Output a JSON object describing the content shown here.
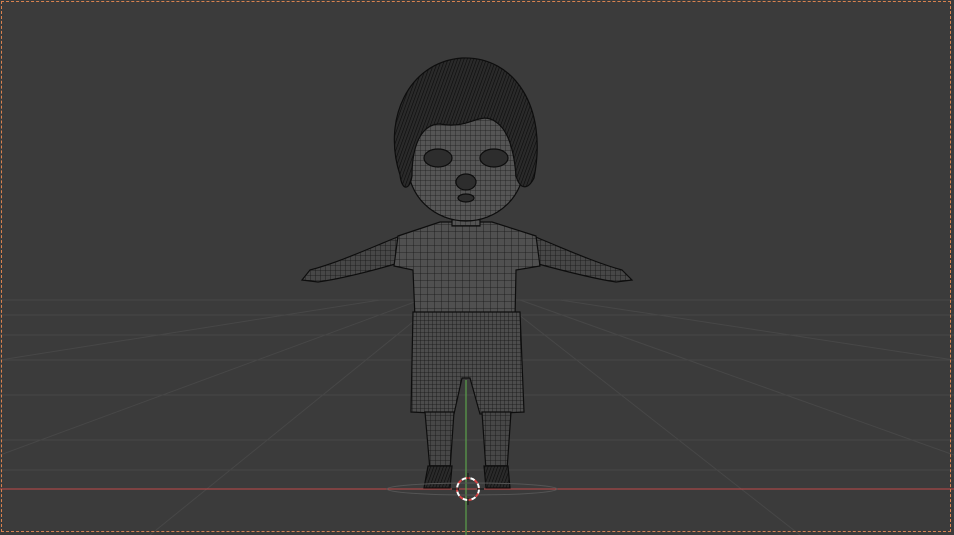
{
  "viewport": {
    "mode": "wireframe",
    "view": "front-orthographic",
    "background_color": "#3b3b3b",
    "grid_color": "#4a4a4a",
    "wire_color": "#0d0d0d",
    "x_axis_color": "#c04a4a",
    "z_axis_color": "#5aa04a",
    "camera_frame_color": "#d8824f",
    "cursor_colors": [
      "#ffffff",
      "#d94444"
    ]
  },
  "scene": {
    "object": "character-child-t-pose",
    "parts": [
      "hair",
      "face",
      "shirt",
      "arms",
      "shorts",
      "legs",
      "shoes"
    ]
  }
}
